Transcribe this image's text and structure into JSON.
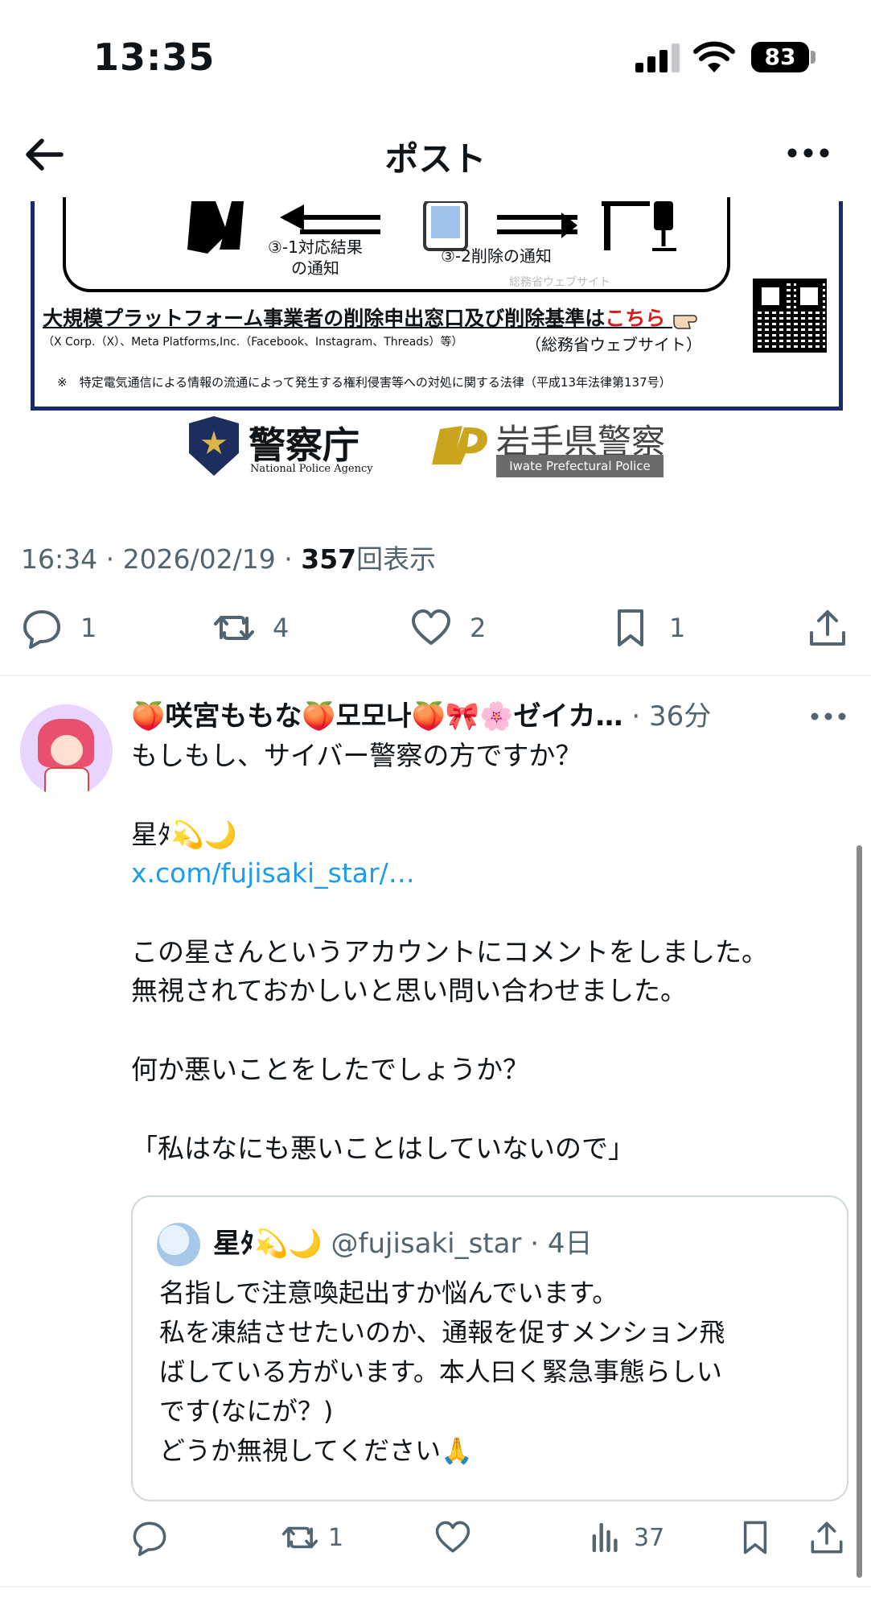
{
  "status_bar": {
    "time": "13:35",
    "battery": "83",
    "icons": [
      "cellular-signal-icon",
      "wifi-icon",
      "battery-icon"
    ]
  },
  "nav": {
    "title": "ポスト",
    "back_icon": "arrow-left-icon",
    "more_icon": "more-horizontal-icon"
  },
  "media": {
    "label_1a": "③-1対応結果",
    "label_1b": "の通知",
    "label_2": "③-2削除の通知",
    "faded_text": "総務省ウェブサイト",
    "heading": "大規模プラットフォーム事業者の削除申出窓口及び削除基準は",
    "heading_link": "こちら",
    "sub": "（X Corp.（X）、Meta Platforms,Inc.（Facebook、Instagram、Threads）等）",
    "sub2": "（総務省ウェブサイト）",
    "note": "※　特定電気通信による情報の流通によって発生する権利侵害等への対処に関する法律（平成13年法律第137号）",
    "logo_npa": "警察庁",
    "logo_npa_sub": "National Police Agency",
    "logo_iwate": "岩手県警察",
    "logo_iwate_sub": "Iwate Prefectural Police"
  },
  "meta": {
    "time_date": "16:34 · 2026/02/19 · ",
    "views": "357",
    "views_label": "回表示"
  },
  "actions_main": {
    "replies": "1",
    "reposts": "4",
    "likes": "2",
    "bookmarks": "1"
  },
  "reply": {
    "author": "🍑咲宮ももな🍑모모나🍑🎀🌸ゼイカ…",
    "time": " · 36分",
    "lines": [
      "もしもし、サイバー警察の方ですか？",
      "星ﾀ💫🌙",
      "x.com/fujisaki_star/…",
      "この星さんというアカウントにコメントをしました。",
      "無視されておかしいと思い問い合わせました。",
      "何か悪いことをしたでしょうか？",
      "「私はなにも悪いことはしていないので」"
    ]
  },
  "quote": {
    "name": "星ﾀ💫🌙",
    "handle": " @fujisaki_star · 4日",
    "lines": [
      "名指しで注意喚起出すか悩んでいます。",
      "私を凍結させたいのか、通報を促すメンション飛",
      "ばしている方がいます。本人曰く緊急事態らしい",
      "です(なにが？)",
      "どうか無視してください🙏"
    ]
  },
  "actions_reply": {
    "reposts": "1",
    "views": "37"
  },
  "colors": {
    "accent": "#1d9bf0",
    "secondary_text": "#536471",
    "border": "#cfd9de"
  }
}
